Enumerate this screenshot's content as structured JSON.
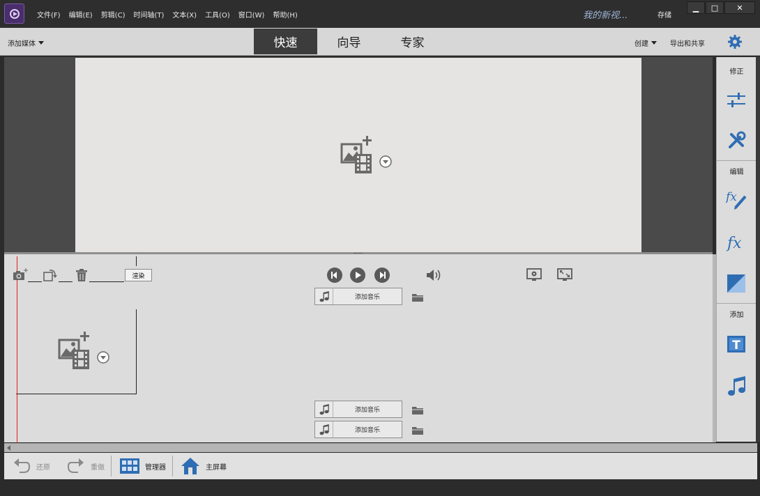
{
  "menu": [
    "文件(F)",
    "编辑(E)",
    "剪辑(C)",
    "时间轴(T)",
    "文本(X)",
    "工具(O)",
    "窗口(W)",
    "帮助(H)"
  ],
  "project_name": "我的新视...",
  "save_label": "存储",
  "window": {
    "minimize": "▁",
    "maximize": "□",
    "close": "✕"
  },
  "modebar": {
    "add_media": "添加媒体",
    "tabs": [
      "快速",
      "向导",
      "专家"
    ],
    "active_tab": "快速",
    "create": "创建",
    "export": "导出和共享"
  },
  "right_panel": {
    "sections": [
      "修正",
      "编辑",
      "添加"
    ]
  },
  "timeline": {
    "render": "渲染",
    "tracks": [
      "添加音乐",
      "添加音乐",
      "添加音乐"
    ]
  },
  "bottombar": {
    "undo": "还原",
    "redo": "重做",
    "organizer": "管理器",
    "home": "主屏幕"
  },
  "colors": {
    "accent_blue": "#2f6db3",
    "playhead": "#dd2222",
    "active_tab_bg": "#3c3c3c"
  },
  "icons": {
    "logo": "premiere-elements-logo-icon",
    "settings": "gear-icon",
    "adjust": "sliders-icon",
    "tools": "tools-icon",
    "fx_edit": "fx-pencil-icon",
    "fx": "fx-icon",
    "transition": "transition-icon",
    "title": "text-title-icon",
    "music": "music-note-icon",
    "camera": "camera-icon",
    "rotate": "rotate-icon",
    "delete": "trash-icon",
    "prev": "previous-frame-icon",
    "play": "play-icon",
    "next": "next-frame-icon",
    "volume": "volume-icon",
    "monitor_settings": "monitor-settings-icon",
    "fit_screen": "fit-screen-icon",
    "folder": "folder-icon",
    "undo": "undo-icon",
    "redo": "redo-icon",
    "organizer": "grid-icon",
    "home": "home-icon",
    "add_media": "add-media-icon"
  }
}
